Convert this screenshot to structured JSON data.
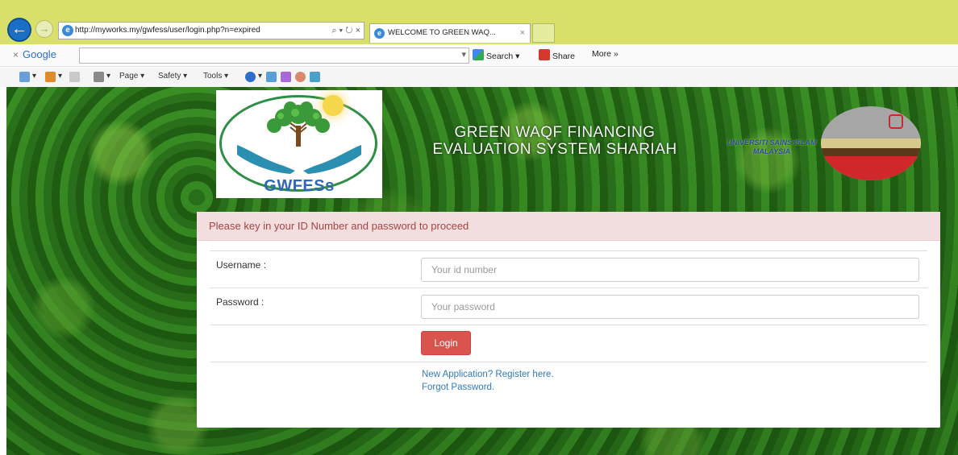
{
  "browser": {
    "address": "http://myworks.my/gwfess/user/login.php?n=expired",
    "address_actions": "⌕ ▾ ↻ ×",
    "tab_title": "WELCOME TO GREEN WAQ...",
    "tab_close": "×",
    "back_glyph": "←",
    "forward_glyph": "→",
    "google_close": "×",
    "google_logo": "Google",
    "google_buttons": {
      "search": "Search ▾",
      "share": "Share",
      "more": "More »"
    },
    "command_items": {
      "page": "Page ▾",
      "safety": "Safety ▾",
      "tools": "Tools ▾"
    }
  },
  "header": {
    "logo_text": "GWFESs",
    "title_line1": "GREEN WAQF FINANCING",
    "title_line2": "EVALUATION SYSTEM SHARIAH",
    "uni_text": "UNIVERSITI SAINS ISLAM MALAYSIA"
  },
  "login": {
    "alert": "Please key in your ID Number and password to proceed",
    "username_label": "Username :",
    "username_placeholder": "Your id number",
    "password_label": "Password :",
    "password_placeholder": "Your password",
    "login_button": "Login",
    "register_link": "New Application? Register here.",
    "forgot_link": "Forgot Password."
  },
  "footer": {
    "text": ""
  },
  "colors": {
    "chrome": "#d9e06a",
    "alert_bg": "#f2dede",
    "alert_text": "#a94442",
    "login_button": "#d9534f",
    "link": "#337ab7",
    "logo_green": "#2e8e45",
    "logo_blue": "#2f67b8"
  },
  "icons": [
    "back-arrow-icon",
    "forward-arrow-icon",
    "ie-icon",
    "refresh-icon",
    "search-icon",
    "google-share-icon",
    "home-icon",
    "feeds-icon",
    "mail-icon",
    "print-icon",
    "help-icon"
  ]
}
